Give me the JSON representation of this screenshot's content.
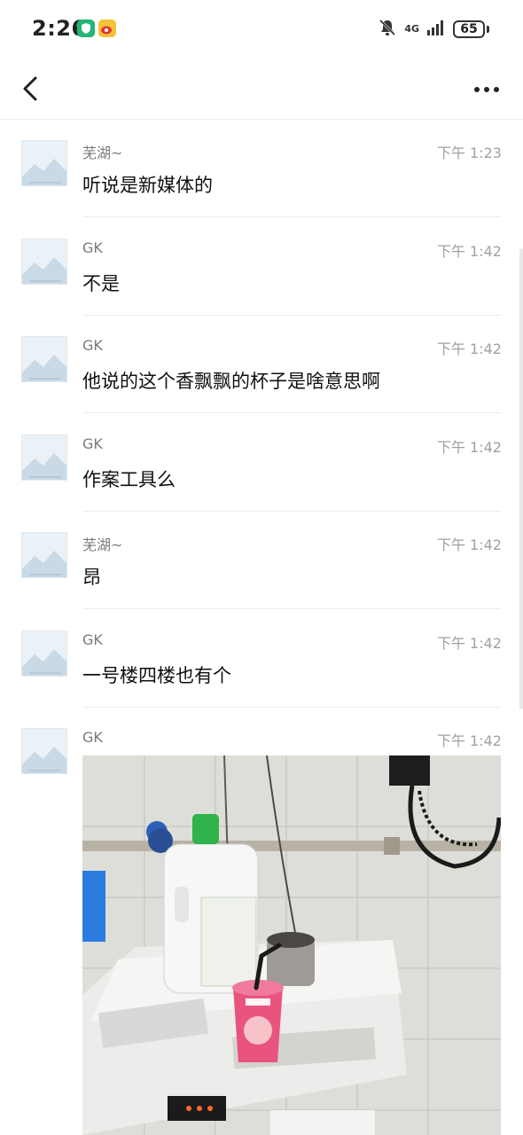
{
  "status_bar": {
    "time": "2:26",
    "network": "4G",
    "battery": "65"
  },
  "icons": {
    "back": "back-arrow-icon",
    "more": "more-dots-icon",
    "mute": "bell-mute-icon",
    "signal": "signal-icon"
  },
  "messages": [
    {
      "sender": "芜湖~",
      "time": "下午 1:23",
      "text": "听说是新媒体的"
    },
    {
      "sender": "GK",
      "time": "下午 1:42",
      "text": "不是"
    },
    {
      "sender": "GK",
      "time": "下午 1:42",
      "text": "他说的这个香飘飘的杯子是啥意思啊"
    },
    {
      "sender": "GK",
      "time": "下午 1:42",
      "text": "作案工具么"
    },
    {
      "sender": "芜湖~",
      "time": "下午 1:42",
      "text": "昂"
    },
    {
      "sender": "GK",
      "time": "下午 1:42",
      "text": "一号楼四楼也有个"
    },
    {
      "sender": "GK",
      "time": "下午 1:42",
      "text": ""
    }
  ],
  "colors": {
    "accent_pink": "#e8547e",
    "divider": "#ececec"
  }
}
